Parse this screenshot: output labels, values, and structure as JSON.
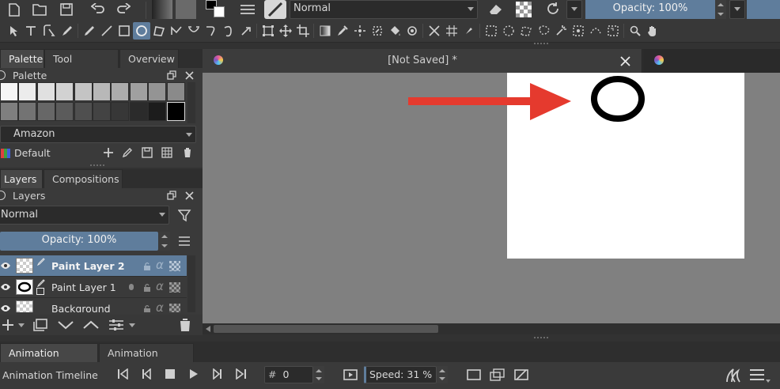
{
  "toolbar": {
    "blend_mode": "Normal",
    "opacity_label": "Opacity: 100%"
  },
  "document_tab": {
    "title": "[Not Saved]",
    "modified_marker": "*"
  },
  "docker_top": {
    "tabs": [
      "Palette",
      "Tool Options",
      "Overview"
    ],
    "active_tab": 0,
    "panel_title": "Palette",
    "palette_name": "Amazon",
    "palette_set": "Default",
    "swatch_rows": [
      [
        "#f6f6f6",
        "#ececec",
        "#e0e0e0",
        "#d2d2d2",
        "#c4c4c4",
        "#b8b8b8",
        "#acacac",
        "#a0a0a0",
        "#949494",
        "#8a8a8a"
      ],
      [
        "#7f7f7f",
        "#737373",
        "#676767",
        "#5b5b5b",
        "#4f4f4f",
        "#434343",
        "#373737",
        "#2b2b2b",
        "#1c1c1c",
        "#000000"
      ]
    ]
  },
  "docker_layers": {
    "tabs": [
      "Layers",
      "Compositions"
    ],
    "active_tab": 0,
    "panel_title": "Layers",
    "blend_mode": "Normal",
    "opacity_label": "Opacity:  100%",
    "layers": [
      {
        "name": "Paint Layer 2",
        "selected": true
      },
      {
        "name": "Paint Layer 1",
        "selected": false
      },
      {
        "name": "Background",
        "selected": false
      }
    ]
  },
  "bottom": {
    "tabs": [
      "Animation Timeline",
      "Animation Curves"
    ],
    "active_tab": 0,
    "panel_title": "Animation Timeline",
    "frame_prefix": "#",
    "frame_value": "0",
    "speed_label": "Speed: 31 %"
  },
  "colors": {
    "accent": "#5f7d9c",
    "arrow": "#e53a2e",
    "canvas_bg": "#808080",
    "document": "#ffffff"
  }
}
